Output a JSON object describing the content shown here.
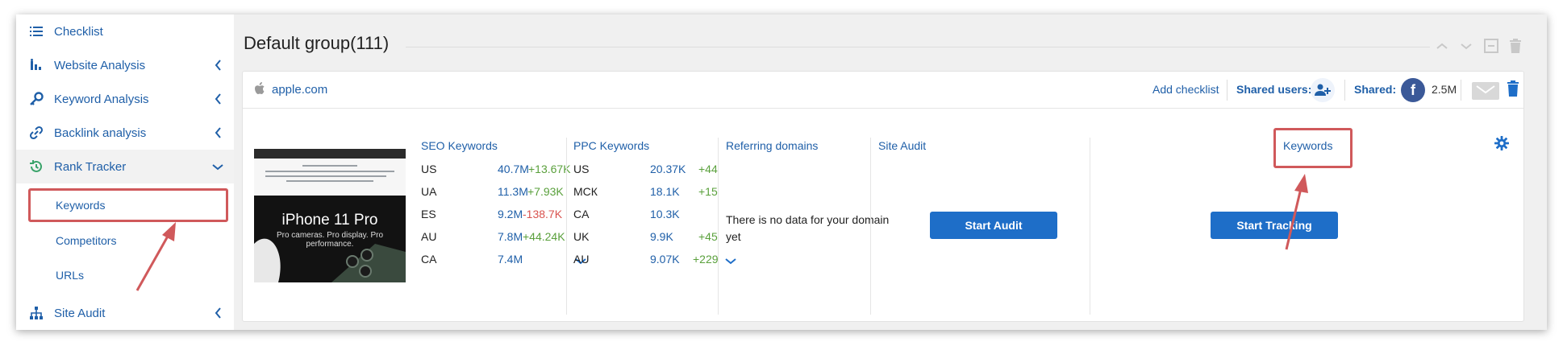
{
  "sidebar": {
    "items": [
      {
        "label": "Checklist",
        "icon": "list-icon",
        "has_chevron": false
      },
      {
        "label": "Website Analysis",
        "icon": "chart-icon",
        "has_chevron": true
      },
      {
        "label": "Keyword Analysis",
        "icon": "key-icon",
        "has_chevron": true
      },
      {
        "label": "Backlink analysis",
        "icon": "link-icon",
        "has_chevron": true
      },
      {
        "label": "Rank Tracker",
        "icon": "history-icon",
        "has_chevron": true,
        "expanded": true
      },
      {
        "label": "Site Audit",
        "icon": "sitemap-icon",
        "has_chevron": true
      }
    ],
    "subitems": [
      {
        "label": "Keywords",
        "highlighted": true
      },
      {
        "label": "Competitors"
      },
      {
        "label": "URLs"
      }
    ]
  },
  "group": {
    "title": "Default group(111)"
  },
  "card": {
    "domain": "apple.com",
    "add_checklist": "Add checklist",
    "shared_users_label": "Shared users:",
    "shared_label": "Shared:",
    "facebook_count": "2.5M",
    "thumbnail": {
      "title": "iPhone 11 Pro",
      "subtitle": "Pro cameras. Pro display. Pro performance."
    },
    "seo": {
      "title": "SEO Keywords",
      "rows": [
        {
          "country": "US",
          "value": "40.7M",
          "delta": "+13.67K",
          "trend": "pos"
        },
        {
          "country": "UA",
          "value": "11.3M",
          "delta": "+7.93K",
          "trend": "pos"
        },
        {
          "country": "ES",
          "value": "9.2M",
          "delta": "-138.7K",
          "trend": "neg"
        },
        {
          "country": "AU",
          "value": "7.8M",
          "delta": "+44.24K",
          "trend": "pos"
        },
        {
          "country": "CA",
          "value": "7.4M",
          "delta": "",
          "trend": "pos"
        }
      ]
    },
    "ppc": {
      "title": "PPC Keywords",
      "rows": [
        {
          "country": "US",
          "value": "20.37K",
          "delta": "+44",
          "trend": "pos"
        },
        {
          "country": "МСК",
          "value": "18.1K",
          "delta": "+15",
          "trend": "pos"
        },
        {
          "country": "CA",
          "value": "10.3K",
          "delta": "",
          "trend": "pos"
        },
        {
          "country": "UK",
          "value": "9.9K",
          "delta": "+45",
          "trend": "pos"
        },
        {
          "country": "AU",
          "value": "9.07K",
          "delta": "+229",
          "trend": "pos"
        }
      ]
    },
    "referring": {
      "title": "Referring domains",
      "message": "There is no data for your domain yet"
    },
    "site_audit": {
      "title": "Site Audit",
      "button": "Start Audit"
    },
    "keywords": {
      "title": "Keywords",
      "button": "Start Tracking"
    }
  },
  "colors": {
    "link": "#1f5fa8",
    "button": "#1e6ec8",
    "highlight": "#d0595b",
    "positive": "#5aa03c",
    "negative": "#d9534f"
  }
}
